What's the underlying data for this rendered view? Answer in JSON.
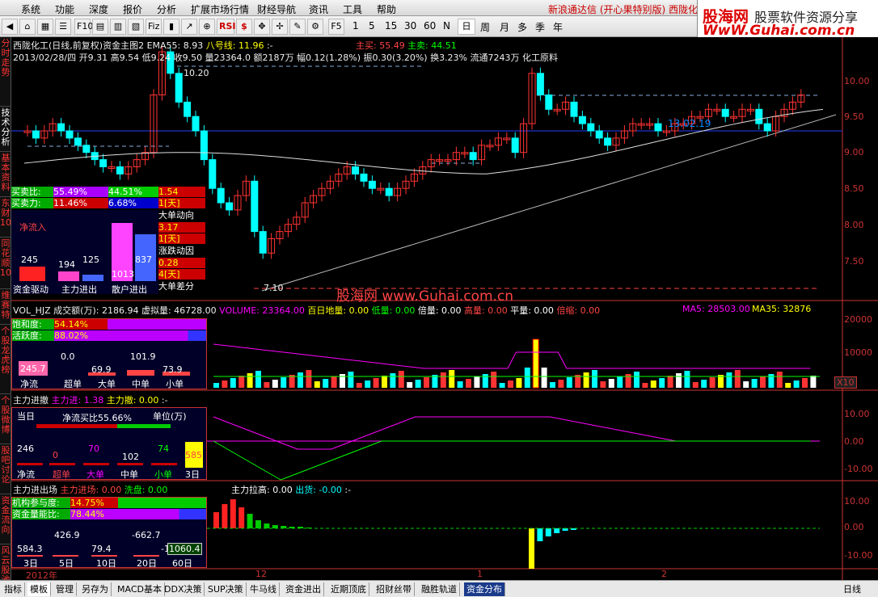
{
  "menu": {
    "items": [
      "系统",
      "功能",
      "深度",
      "报价",
      "分析",
      "扩展市场行情",
      "财经导航",
      "资讯",
      "工具",
      "帮助"
    ],
    "promo": "新浪通达信 (开心果特别版)   西陇化"
  },
  "logo": {
    "l1": "股海网",
    "l2": "股票软件资源分享",
    "l3": "WwW.Guhai.com.cn"
  },
  "toolbar": {
    "periods": [
      "1",
      "5",
      "15",
      "30",
      "60",
      "N",
      "日",
      "周",
      "月",
      "多",
      "季",
      "年"
    ],
    "fs": "F5",
    "rsi": "RSI",
    "dollar": "$"
  },
  "lefttabs": [
    "分时走势",
    "技术分析",
    "基本资料",
    "东财10",
    "同花顺10",
    "维赛特",
    "个股龙虎榜",
    "个股微博",
    "股吧讨论",
    "资金流向",
    "风云股池"
  ],
  "main": {
    "title": "西陇化工(日线,前复权)资金主图2",
    "ema": "EMA55: 8.93",
    "bahao": "八号线: 11.96",
    "dash": ":-",
    "zhumai": "主买: 55.49",
    "zhumai2": "主卖: 44.51",
    "info": "2013/02/28/四 开9.31 高9.54 低9.24 收9.50 量23364.0 额2187万 幅0.12(1.28%) 振0.30(3.20%) 换3.23% 流通7243万 化工原料",
    "ticks": [
      "10.00",
      "9.50",
      "9.00",
      "8.50",
      "8.00",
      "7.50"
    ],
    "hi": "10.20",
    "lo": "7.10",
    "mid": "13.02.19",
    "watermark": "股海网 www.Guhai.com.cn"
  },
  "buysell": {
    "mmb": "买卖比:",
    "mmb1": "55.49",
    "pct": "%",
    "mmb2": "44.51",
    "mml": "买卖力:",
    "mml1": "11.46",
    "mml2": "6.68",
    "v1": "1.54",
    "d1": "1[天]",
    "ddx": "大单动向",
    "v2": "3.17",
    "d2": "1[天]",
    "zdy": "涨跌动因",
    "v3": "0.28",
    "d3": "4[天]",
    "ddc": "大单差分",
    "jlr": "净流入",
    "b1": "245",
    "b2": "194",
    "b3": "125",
    "b4": "1013",
    "b5": "837",
    "l1": "资金驱动",
    "l2": "主力进出",
    "l3": "散户进出"
  },
  "vol": {
    "hdr": "VOL_HJZ",
    "cje": "成交额(万): 2186.94",
    "xnl": "虚拟量: 46728.00",
    "volume": "VOLUME: 23364.00",
    "bai": "百日地量: 0.00",
    "di": "低量: 0.00",
    "bei": "倍量: 0.00",
    "gao": "高量: 0.00",
    "ping": "平量: 0.00",
    "bs": "倍缩: 0.00",
    "ma5": "MA5: 28503.00",
    "ma35": "MA35: 32876",
    "ticks": [
      "20000",
      "10000"
    ],
    "x10": "X10",
    "bhd": "饱和度:",
    "bhd_v": "54.14",
    "hyd": "活跃度:",
    "hyd_v": "88.02",
    "pct": "%",
    "n1": "245.7",
    "n2": "0.0",
    "n3": "69.9",
    "n4": "101.9",
    "n5": "73.9",
    "l1": "净流",
    "l2": "超单",
    "l3": "大单",
    "l4": "中单",
    "l5": "小单"
  },
  "zljc": {
    "hdr": "主力进撤",
    "in": "主力进: 1.38",
    "out": "主力撤: 0.00",
    "dash": ":-",
    "ticks": [
      "10.00",
      "0.00",
      "-10.00"
    ],
    "today": "当日",
    "jlmb": "净流买比55.66%",
    "unit": "单位(万)",
    "n1": "246",
    "n2": "0",
    "n3": "70",
    "n4": "102",
    "n5": "74",
    "n6": "585",
    "l1": "净流",
    "l2": "超单",
    "l3": "大单",
    "l4": "中单",
    "l5": "小单",
    "l6": "3日"
  },
  "zljcc": {
    "hdr": "主力进出场",
    "in": "主力进场: 0.00",
    "wash": "洗盘: 0.00",
    "lg": "主力拉高: 0.00",
    "ch": "出货: -0.00",
    "dash": ":-",
    "ticks": [
      "10.00",
      "0.00",
      "-10.00"
    ],
    "jg": "机构参与度:",
    "jg_v": "14.75",
    "zj": "资金量能比:",
    "zj_v": "78.44",
    "pct": "%",
    "v1": "426.9",
    "v2": "-662.7",
    "v3": "584.3",
    "v4": "79.4",
    "v5": "-1",
    "v6": "1060.4",
    "d1": "3日",
    "d2": "5日",
    "d3": "10日",
    "d4": "20日",
    "d5": "60日"
  },
  "xaxis": {
    "y": "2012年",
    "m1": "12",
    "m2": "1",
    "m3": "2"
  },
  "bottom": {
    "tabs": [
      "指标",
      "模板",
      "管理",
      "另存为",
      "MACD基本",
      "DDX决策",
      "SUP决策",
      "牛马线",
      "资金进出",
      "近期顶底",
      "招财丝带",
      "融胜轨道",
      "资金分布"
    ],
    "right": "日线"
  }
}
